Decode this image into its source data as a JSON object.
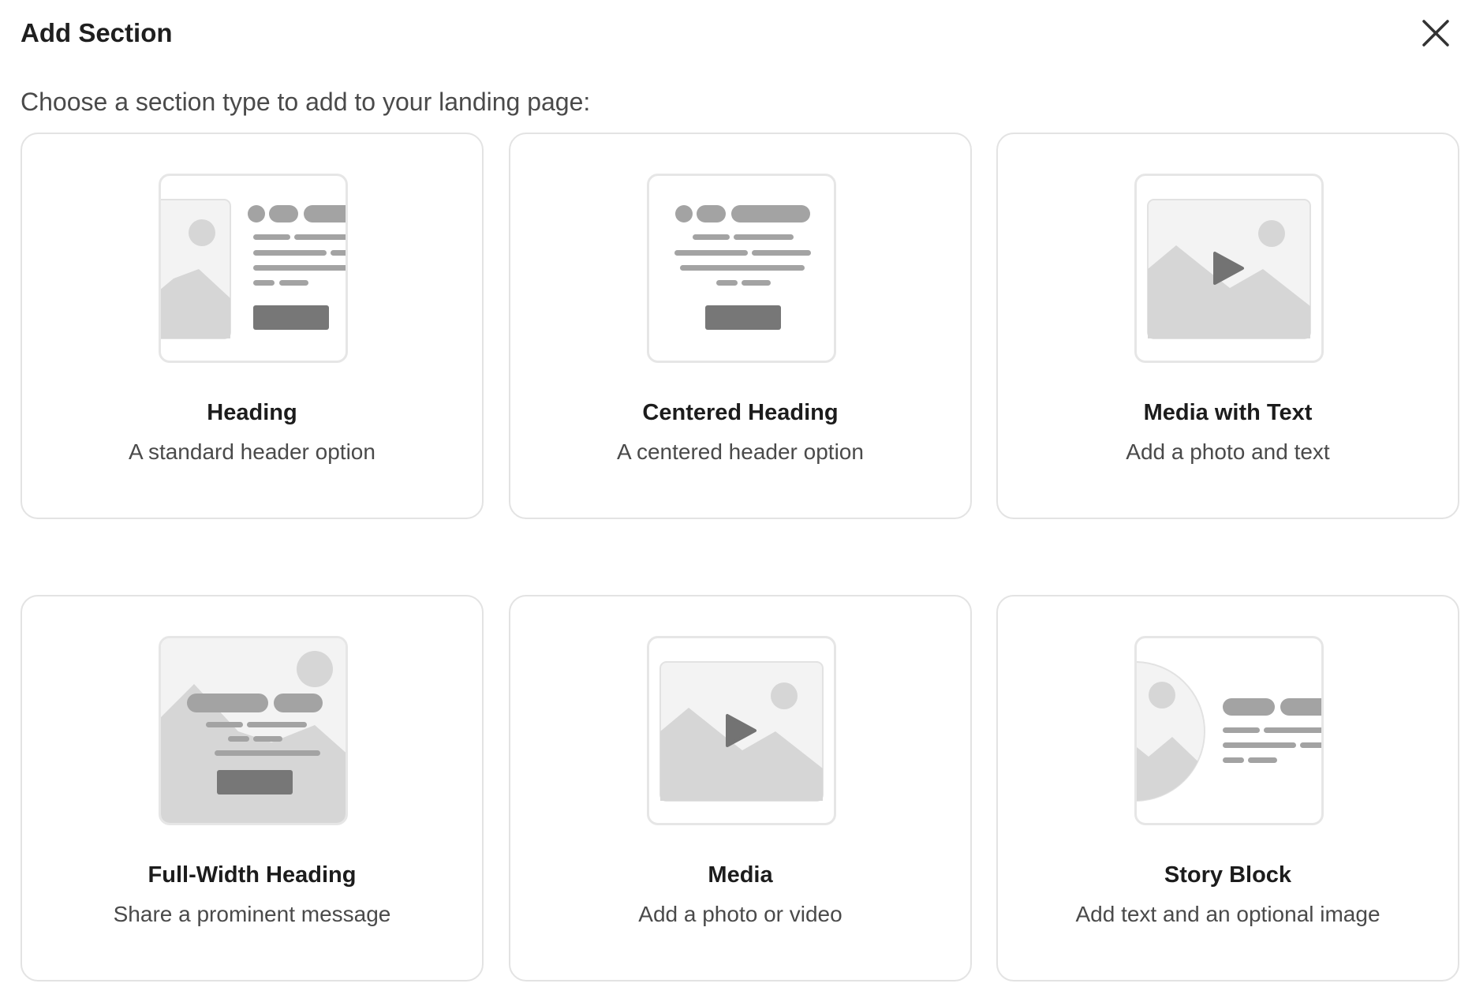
{
  "dialog": {
    "title": "Add Section",
    "close_icon": "close-icon",
    "subtitle": "Choose a section type to add to your landing page:"
  },
  "sections": [
    {
      "title": "Heading",
      "description": "A standard header option",
      "icon": "heading-layout-icon"
    },
    {
      "title": "Centered Heading",
      "description": "A centered header option",
      "icon": "centered-heading-layout-icon"
    },
    {
      "title": "Media with Text",
      "description": "Add a photo and text",
      "icon": "media-with-text-layout-icon"
    },
    {
      "title": "Full-Width Heading",
      "description": "Share a prominent message",
      "icon": "full-width-heading-layout-icon"
    },
    {
      "title": "Media",
      "description": "Add a photo or video",
      "icon": "media-layout-icon"
    },
    {
      "title": "Story Block",
      "description": "Add text and an optional image",
      "icon": "story-block-layout-icon"
    }
  ],
  "colors": {
    "card_border": "#e3e3e3",
    "placeholder_light": "#f3f3f3",
    "placeholder_mid": "#d6d6d6",
    "placeholder_dark": "#a3a3a3",
    "button_dark": "#777777"
  }
}
